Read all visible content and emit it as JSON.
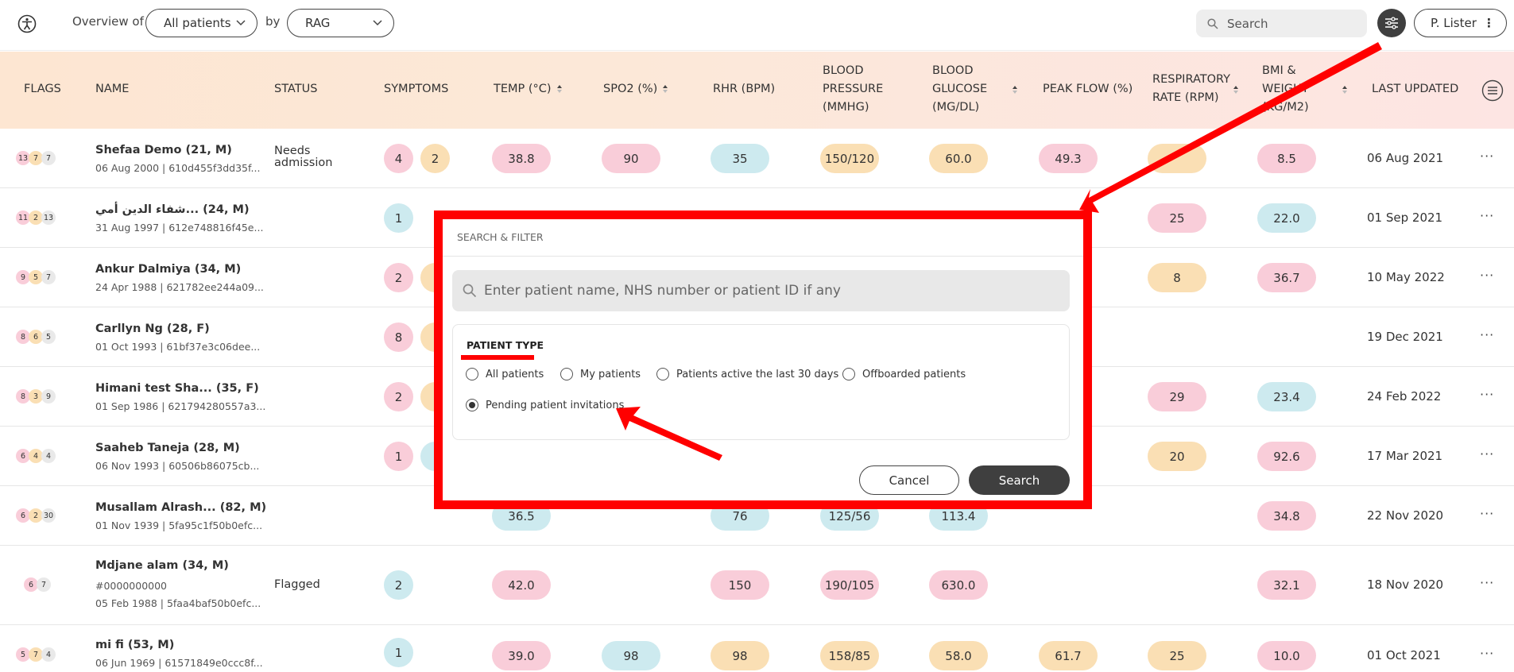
{
  "topbar": {
    "overview_label": "Overview of",
    "patients_select": "All patients",
    "by_label": "by",
    "rag_select": "RAG",
    "search_placeholder": "Search",
    "user_name": "P. Lister",
    "user_menu_icon": "⋮"
  },
  "columns": {
    "flags": "FLAGS",
    "name": "NAME",
    "status": "STATUS",
    "symptoms": "SYMPTOMS",
    "temp": "TEMP (°C)",
    "spo2": "SPO2 (%)",
    "rhr": "RHR (BPM)",
    "bp_1": "BLOOD",
    "bp_2": "PRESSURE",
    "bp_3": "(MMHG)",
    "bg_1": "BLOOD",
    "bg_2": "GLUCOSE",
    "bg_3": "(MG/DL)",
    "peak_flow": "PEAK FLOW (%)",
    "resp_1": "RESPIRATORY",
    "resp_2": "RATE (RPM)",
    "bmi_1": "BMI &",
    "bmi_2": "WEIGHT",
    "bmi_3": "(KG/M2)",
    "last_updated": "LAST UPDATED"
  },
  "rows": [
    {
      "flags": [
        "13",
        "7",
        "7"
      ],
      "name": "Shefaa Demo (21, M)",
      "sub1": "06 Aug 2000 | 610d455f3dd35f...",
      "status_1": "Needs",
      "status_2": "admission",
      "symptoms": [
        "4",
        "2"
      ],
      "temp": "38.8",
      "spo2": "90",
      "rhr": "35",
      "bp": "150/120",
      "bg": "60.0",
      "peak": "49.3",
      "resp": "",
      "bmi": "8.5",
      "updated": "06 Aug 2021"
    },
    {
      "flags": [
        "11",
        "2",
        "13"
      ],
      "name": "شفاء الدين أمي... (24, M)",
      "sub1": "31 Aug 1997 | 612e748816f45e...",
      "symptoms": [
        "1"
      ],
      "resp": "25",
      "bmi": "22.0",
      "updated": "01 Sep 2021"
    },
    {
      "flags": [
        "9",
        "5",
        "7"
      ],
      "name": "Ankur Dalmiya (34, M)",
      "sub1": "24 Apr 1988 | 621782ee244a09...",
      "symptoms": [
        "2"
      ],
      "resp": "8",
      "bmi": "36.7",
      "updated": "10 May 2022"
    },
    {
      "flags": [
        "8",
        "6",
        "5"
      ],
      "name": "Carllyn Ng (28, F)",
      "sub1": "01 Oct 1993 | 61bf37e3c06dee...",
      "symptoms": [
        "8"
      ],
      "updated": "19 Dec 2021"
    },
    {
      "flags": [
        "8",
        "3",
        "9"
      ],
      "name": "Himani test Sha... (35, F)",
      "sub1": "01 Sep 1986 | 621794280557a3...",
      "symptoms": [
        "2"
      ],
      "resp": "29",
      "bmi": "23.4",
      "updated": "24 Feb 2022"
    },
    {
      "flags": [
        "6",
        "4",
        "4"
      ],
      "name": "Saaheb Taneja (28, M)",
      "sub1": "06 Nov 1993 | 60506b86075cb...",
      "symptoms": [
        "1"
      ],
      "resp": "20",
      "bmi": "92.6",
      "updated": "17 Mar 2021"
    },
    {
      "flags": [
        "6",
        "2",
        "30"
      ],
      "name": "Musallam Alrash... (82, M)",
      "sub1": "01 Nov 1939 | 5fa95c1f50b0efc...",
      "temp": "36.5",
      "rhr": "76",
      "bp": "125/56",
      "bg": "113.4",
      "bmi": "34.8",
      "updated": "22 Nov 2020"
    },
    {
      "flags": [
        "6",
        "7"
      ],
      "name": "Mdjane alam (34, M)",
      "sub1": "#0000000000",
      "sub2": "05 Feb 1988 | 5faa4baf50b0efc...",
      "status_1": "Flagged",
      "symptoms": [
        "2"
      ],
      "temp": "42.0",
      "rhr": "150",
      "bp": "190/105",
      "bg": "630.0",
      "bmi": "32.1",
      "updated": "18 Nov 2020"
    },
    {
      "flags": [
        "5",
        "7",
        "4"
      ],
      "name": "mi fi (53, M)",
      "sub1": "06 Jun 1969 | 61571849e0ccc8f...",
      "symptoms": [
        "1"
      ],
      "temp": "39.0",
      "spo2": "98",
      "rhr": "98",
      "bp": "158/85",
      "bg": "58.0",
      "peak": "61.7",
      "resp": "25",
      "bmi": "10.0",
      "updated": "01 Oct 2021"
    }
  ],
  "row_menu": "···",
  "modal": {
    "title": "SEARCH & FILTER",
    "search_placeholder": "Enter patient name, NHS number or patient ID if any",
    "patient_type_title": "PATIENT TYPE",
    "options": [
      "All patients",
      "My patients",
      "Patients active the last 30 days",
      "Offboarded patients",
      "Pending patient invitations"
    ],
    "selected_option": "Pending patient invitations",
    "cancel_label": "Cancel",
    "search_label": "Search"
  },
  "icons": [
    "accessibility-logo-icon",
    "chevron-down-icon",
    "search-icon",
    "filter-sliders-icon",
    "more-vertical-icon",
    "sort-icon",
    "list-menu-icon",
    "more-horizontal-icon"
  ],
  "colors": {
    "red_pill": "#f9cdd9",
    "blue_pill": "#cdeaef",
    "orange_pill": "#fadfb4",
    "annotation": "#ff0000",
    "dark_button": "#3f3f3f"
  }
}
